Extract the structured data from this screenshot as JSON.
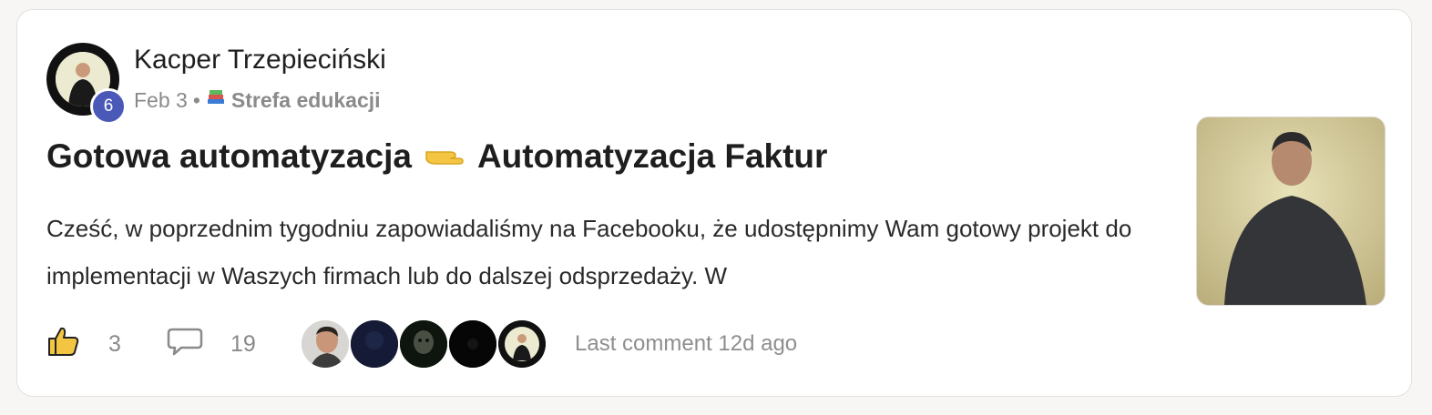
{
  "post": {
    "author": {
      "name": "Kacper Trzepieciński",
      "level": "6"
    },
    "date": "Feb 3",
    "separator": "•",
    "category_icon": "books-emoji",
    "category": "Strefa edukacji",
    "title_part1": "Gotowa automatyzacja",
    "title_emoji": "pointing-right-emoji",
    "title_part2": "Automatyzacja Faktur",
    "body": "Cześć, w poprzednim tygodniu zapowiadaliśmy na Facebooku, że udostępnimy Wam gotowy projekt do implementacji w Waszych firmach lub do dalszej odsprzedaży. W",
    "thumbnail": "video-thumbnail-man"
  },
  "footer": {
    "likes": "3",
    "comments": "19",
    "last_comment": "Last comment 12d ago",
    "commenter_avatars": [
      "avatar-man-smiling",
      "avatar-dark-blue",
      "avatar-clown",
      "avatar-black",
      "avatar-kacper"
    ]
  },
  "colors": {
    "level_badge": "#4a59b8",
    "card_border": "#e2e1de",
    "muted_text": "#8a8a8a"
  }
}
